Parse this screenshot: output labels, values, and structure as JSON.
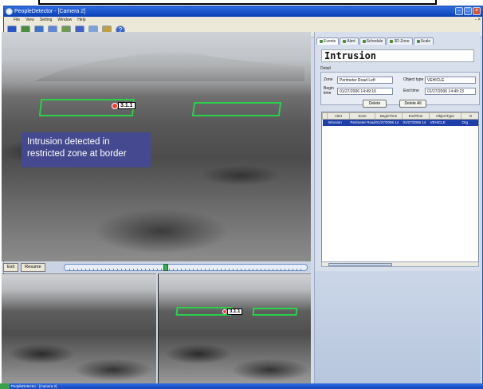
{
  "window": {
    "title": "PeopleDetector - [Camera 2]"
  },
  "menu": {
    "items": [
      "File",
      "View",
      "Setting",
      "Window",
      "Help"
    ],
    "right_symbol": "- ×"
  },
  "video": {
    "overlay_text": "Intrusion detected in restricted  zone at border",
    "target_label": "3.1.1",
    "thumb_target_label": "3.1.1"
  },
  "playback": {
    "exit_label": "Exit",
    "resume_label": "Resume",
    "position": 0.42
  },
  "tabs": [
    "Events",
    "Alert",
    "Schedule",
    "3D Zone",
    "Scale"
  ],
  "alert_detail": {
    "heading": "Intrusion",
    "section_label": "Detail",
    "zone_label": "Zone",
    "zone_value": "Perimeter Road Left",
    "object_type_label": "Object type",
    "object_type_value": "VEHICLE",
    "begin_time_label": "Begin time",
    "begin_time_value": "01/27/2006 14:49:16",
    "end_time_label": "End time",
    "end_time_value": "01/27/2006 14:49:23",
    "delete_label": "Delete",
    "delete_all_label": "Delete All"
  },
  "alert_table": {
    "columns": [
      "",
      "Alert",
      "Zone",
      "BeginTime",
      "EndTime",
      "ObjectType",
      "O"
    ],
    "rows": [
      [
        "",
        "Intrusion",
        "Perimeter Road",
        "01/27/2006 14",
        "01/27/2006 14",
        "VEHICLE",
        "Org"
      ]
    ]
  },
  "status": {
    "text": "PeopleDetector - [Camera 2]"
  }
}
